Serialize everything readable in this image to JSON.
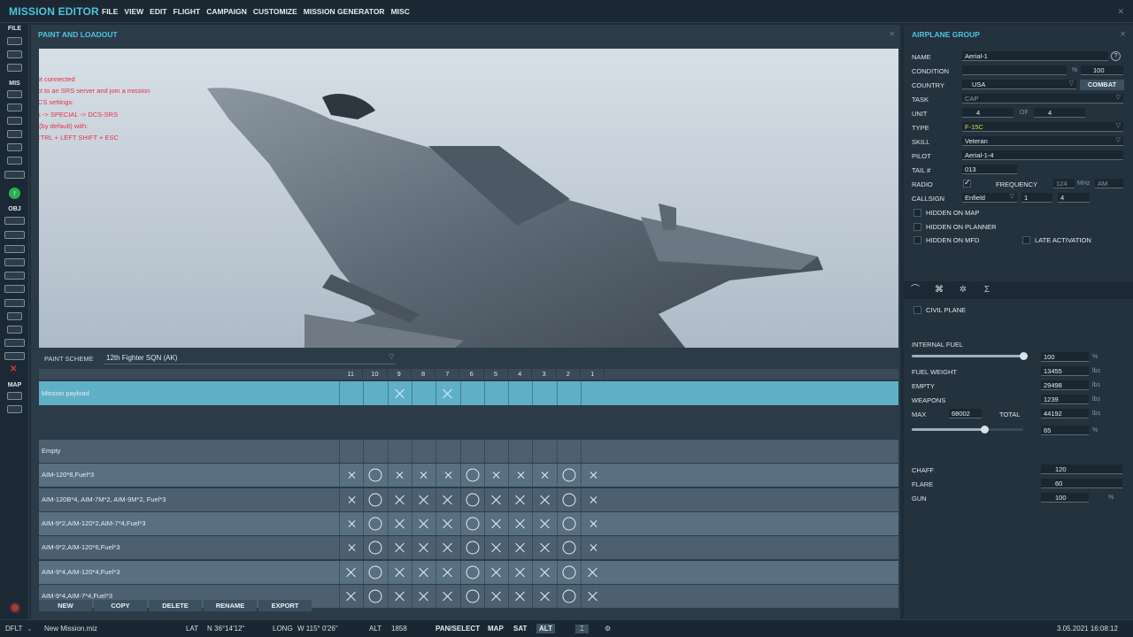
{
  "app": {
    "title": "MISSION EDITOR",
    "menu": [
      "FILE",
      "VIEW",
      "EDIT",
      "FLIGHT",
      "CAMPAIGN",
      "CUSTOMIZE",
      "MISSION GENERATOR",
      "MISC"
    ]
  },
  "toolbar": {
    "file_label": "FILE",
    "mis_label": "MIS",
    "obj_label": "OBJ",
    "map_label": "MAP"
  },
  "paint_panel": {
    "title": "PAINT AND LOADOUT",
    "srs_message": "SRS not connected\nConnect to an SRS server and join a mission\nSRS DCS settings:\nOptions -> SPECIAL -> DCS-SRS\nToggle (by default) with:\nLEFT CTRL + LEFT SHIFT + ESC",
    "paint_scheme_label": "PAINT SCHEME",
    "paint_scheme_value": "12th Fighter SQN (AK)"
  },
  "loadout": {
    "stations": [
      "11",
      "10",
      "9",
      "8",
      "7",
      "6",
      "5",
      "4",
      "3",
      "2",
      "1"
    ],
    "mission_payload_label": "Mission payload",
    "mission_payload_stations": [
      "",
      "",
      "x",
      "",
      "x",
      "",
      "",
      "",
      "",
      "",
      ""
    ],
    "rows": [
      {
        "name": "Empty",
        "stations": [
          "",
          "",
          "",
          "",
          "",
          "",
          "",
          "",
          "",
          "",
          ""
        ]
      },
      {
        "name": "AIM-120*8,Fuel*3",
        "stations": [
          "xs",
          "o",
          "xs",
          "xs",
          "xs",
          "o",
          "xs",
          "xs",
          "xs",
          "o",
          "xs"
        ]
      },
      {
        "name": "AIM-120B*4, AIM-7M*2, AIM-9M*2, Fuel*3",
        "stations": [
          "xs",
          "o",
          "x",
          "x",
          "x",
          "o",
          "x",
          "x",
          "x",
          "o",
          "xs"
        ]
      },
      {
        "name": "AIM-9*2,AIM-120*2,AIM-7*4,Fuel*3",
        "stations": [
          "xs",
          "o",
          "x",
          "x",
          "x",
          "o",
          "x",
          "x",
          "x",
          "o",
          "xs"
        ]
      },
      {
        "name": "AIM-9*2,AIM-120*6,Fuel*3",
        "stations": [
          "xs",
          "o",
          "x",
          "x",
          "x",
          "o",
          "x",
          "x",
          "x",
          "o",
          "xs"
        ]
      },
      {
        "name": "AIM-9*4,AIM-120*4,Fuel*3",
        "stations": [
          "x",
          "o",
          "x",
          "x",
          "x",
          "o",
          "x",
          "x",
          "x",
          "o",
          "x"
        ]
      },
      {
        "name": "AIM-9*4,AIM-7*4,Fuel*3",
        "stations": [
          "x",
          "o",
          "x",
          "x",
          "x",
          "o",
          "x",
          "x",
          "x",
          "o",
          "x"
        ]
      }
    ],
    "buttons": {
      "new": "NEW",
      "copy": "COPY",
      "delete": "DELETE",
      "rename": "RENAME",
      "export": "EXPORT"
    }
  },
  "group": {
    "title": "AIRPLANE GROUP",
    "name_label": "NAME",
    "name_value": "Aerial-1",
    "condition_label": "CONDITION",
    "condition_unit": "%",
    "condition_value": "100",
    "country_label": "COUNTRY",
    "country_value": "USA",
    "combat_button": "COMBAT",
    "task_label": "TASK",
    "task_value": "CAP",
    "unit_label": "UNIT",
    "unit_value": "4",
    "of_label": "OF",
    "unit_total": "4",
    "type_label": "TYPE",
    "type_value": "F-15C",
    "skill_label": "SKILL",
    "skill_value": "Veteran",
    "pilot_label": "PILOT",
    "pilot_value": "Aerial-1-4",
    "tail_label": "TAIL #",
    "tail_value": "013",
    "radio_label": "RADIO",
    "frequency_label": "FREQUENCY",
    "frequency_value": "124",
    "frequency_unit": "MHz",
    "modulation": "AM",
    "callsign_label": "CALLSIGN",
    "callsign_value": "Enfield",
    "callsign_num1": "1",
    "callsign_num2": "4",
    "hidden_map": "HIDDEN ON MAP",
    "hidden_planner": "HIDDEN ON PLANNER",
    "hidden_mfd": "HIDDEN ON MFD",
    "late_activation": "LATE ACTIVATION"
  },
  "payload": {
    "civil_plane": "CIVIL PLANE",
    "internal_fuel_label": "INTERNAL FUEL",
    "internal_fuel_value": "100",
    "internal_fuel_unit": "%",
    "internal_fuel_fraction": 1.0,
    "fuel_weight_label": "FUEL WEIGHT",
    "fuel_weight_value": "13455",
    "fuel_weight_unit": "lbs",
    "empty_label": "EMPTY",
    "empty_value": "29498",
    "empty_unit": "lbs",
    "weapons_label": "WEAPONS",
    "weapons_value": "1239",
    "weapons_unit": "lbs",
    "max_label": "MAX",
    "max_value": "68002",
    "total_label": "TOTAL",
    "total_value": "44192",
    "total_unit": "lbs",
    "load_percent_value": "65",
    "load_percent_unit": "%",
    "load_fraction": 0.65,
    "chaff_label": "CHAFF",
    "chaff_value": "120",
    "flare_label": "FLARE",
    "flare_value": "60",
    "gun_label": "GUN",
    "gun_value": "100",
    "gun_unit": "%"
  },
  "status": {
    "theme": "DFLT",
    "file": "New Mission.miz",
    "lat_label": "LAT",
    "lat_value": "N 36°14'12\"",
    "long_label": "LONG",
    "long_value": "W 115° 0'26\"",
    "alt_label": "ALT",
    "alt_value": "1858",
    "pan_select": "PAN/SELECT",
    "map": "MAP",
    "sat": "SAT",
    "alt_mode": "ALT",
    "datetime": "3.05.2021 16:08:12"
  },
  "colors": {
    "accent": "#4fc3dc",
    "payload_row": "#5fb0c6",
    "srs_text": "#e23348"
  }
}
